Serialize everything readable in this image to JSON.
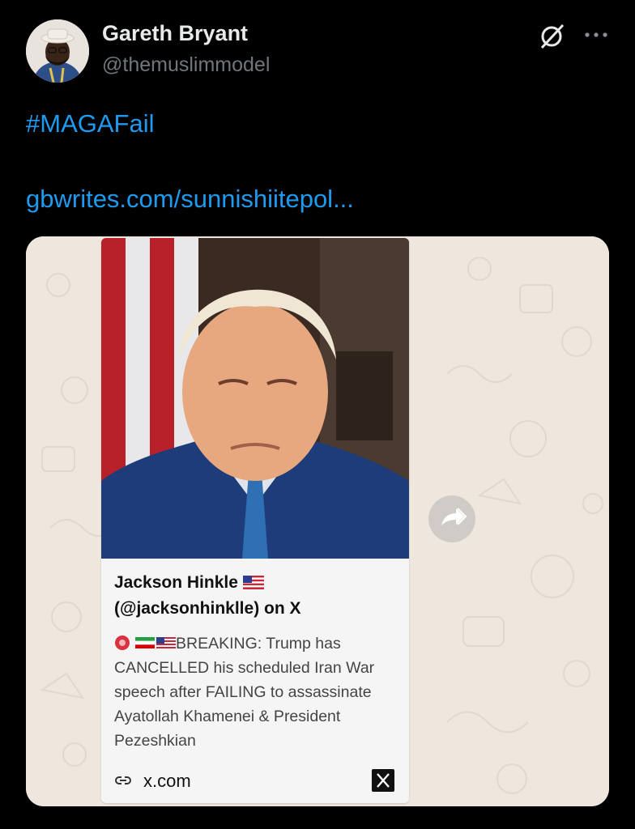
{
  "author": {
    "display_name": "Gareth Bryant",
    "handle": "@themuslimmodel"
  },
  "icons": {
    "grok": "grok-icon",
    "more": "more-icon",
    "link": "link-icon",
    "forward": "forward-icon",
    "x_logo": "x-logo-icon"
  },
  "post": {
    "hashtag": "#MAGAFail",
    "link_text": "gbwrites.com/sunnishiitepol..."
  },
  "link_preview": {
    "title_line1": "Jackson Hinkle",
    "title_line2": "(@jacksonhinklle) on X",
    "description_lead": "BREAKING: Trump has",
    "description_rest": "CANCELLED his scheduled Iran War speech after FAILING to assassinate Ayatollah Khamenei & President Pezeshkian",
    "domain": "x.com"
  },
  "colors": {
    "background": "#000000",
    "link": "#1d9bf0",
    "handle": "#71767b",
    "whatsapp_wallpaper": "#efe7dd"
  }
}
